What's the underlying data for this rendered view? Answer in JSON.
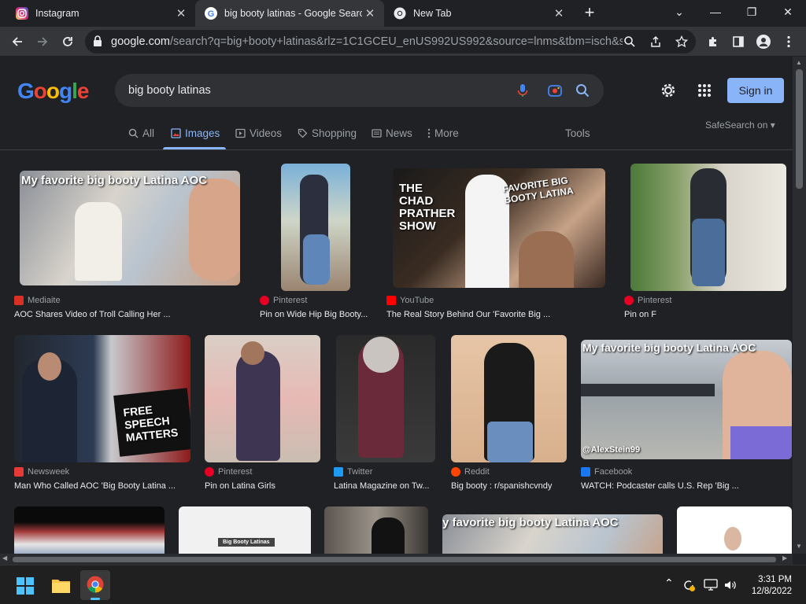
{
  "tabs": [
    {
      "title": "Instagram",
      "active": false
    },
    {
      "title": "big booty latinas - Google Search",
      "active": true
    },
    {
      "title": "New Tab",
      "active": false
    }
  ],
  "address_bar": {
    "host": "google.com",
    "path": "/search?q=big+booty+latinas&rlz=1C1GCEU_enUS992US992&source=lnms&tbm=isch&s..."
  },
  "search": {
    "query": "big booty latinas"
  },
  "header": {
    "signin_label": "Sign in",
    "logo": "Google"
  },
  "nav": {
    "tabs": [
      "All",
      "Images",
      "Videos",
      "Shopping",
      "News",
      "More"
    ],
    "active": "Images",
    "tools": "Tools",
    "safesearch": "SafeSearch on"
  },
  "results": [
    {
      "source": "Mediaite",
      "caption": "AOC Shares Video of Troll Calling Her ...",
      "overlay": "My favorite big booty Latina AOC",
      "favicon_color": "#d93025",
      "favicon_letter": "M"
    },
    {
      "source": "Pinterest",
      "caption": "Pin on Wide Hip Big Booty...",
      "overlay": "",
      "favicon_color": "#e60023",
      "favicon_letter": "P"
    },
    {
      "source": "YouTube",
      "caption": "The Real Story Behind Our 'Favorite Big ...",
      "overlay": "FAVORITE BIG BOOTY LATINA",
      "overlay2": "THE CHAD PRATHER SHOW",
      "favicon_color": "#ff0000",
      "favicon_letter": "▶"
    },
    {
      "source": "Pinterest",
      "caption": "Pin on F",
      "overlay": "",
      "favicon_color": "#e60023",
      "favicon_letter": "P"
    },
    {
      "source": "Newsweek",
      "caption": "Man Who Called AOC 'Big Booty Latina ...",
      "overlay": "FREE SPEECH MATTERS",
      "favicon_color": "#e53935",
      "favicon_letter": "N"
    },
    {
      "source": "Pinterest",
      "caption": "Pin on Latina Girls",
      "overlay": "",
      "favicon_color": "#e60023",
      "favicon_letter": "P"
    },
    {
      "source": "Twitter",
      "caption": "Latina Magazine on Tw...",
      "overlay": "",
      "favicon_color": "#1d9bf0",
      "favicon_letter": "t"
    },
    {
      "source": "Reddit",
      "caption": "Big booty : r/spanishcvndy",
      "overlay": "",
      "favicon_color": "#ff4500",
      "favicon_letter": "r"
    },
    {
      "source": "Facebook",
      "caption": "WATCH: Podcaster calls U.S. Rep 'Big ...",
      "overlay": "My favorite big booty Latina AOC",
      "overlay2": "@AlexStein99",
      "favicon_color": "#1877f2",
      "favicon_letter": "f"
    },
    {
      "source": "",
      "caption": "",
      "overlay": "",
      "favicon_color": "",
      "favicon_letter": ""
    },
    {
      "source": "",
      "caption": "",
      "overlay": "Big Booty Latinas",
      "favicon_color": "",
      "favicon_letter": ""
    },
    {
      "source": "",
      "caption": "",
      "overlay": "",
      "favicon_color": "",
      "favicon_letter": ""
    },
    {
      "source": "",
      "caption": "",
      "overlay": "y favorite big booty Latina AOC",
      "favicon_color": "",
      "favicon_letter": ""
    },
    {
      "source": "",
      "caption": "",
      "overlay": "",
      "favicon_color": "",
      "favicon_letter": ""
    }
  ],
  "taskbar": {
    "time": "3:31 PM",
    "date": "12/8/2022"
  },
  "colors": {
    "accent": "#8ab4f8",
    "background": "#202124",
    "surface": "#303134"
  }
}
